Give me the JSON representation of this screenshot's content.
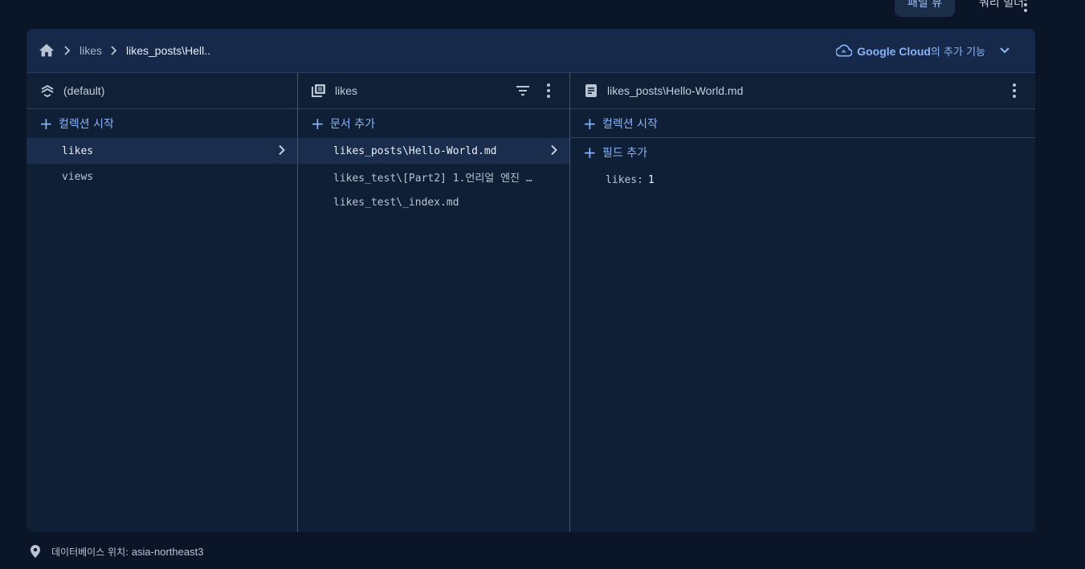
{
  "top_bar": {
    "tabs": [
      {
        "label": "패널 뷰",
        "active": true
      },
      {
        "label": "쿼리 빌더",
        "active": false
      }
    ]
  },
  "breadcrumb": {
    "items": [
      "likes",
      "likes_posts\\Hell.."
    ]
  },
  "google_cloud": {
    "brand": "Google Cloud",
    "suffix": "의 추가 기능"
  },
  "columns": {
    "database": {
      "title": "(default)",
      "add_label": "컬렉션 시작",
      "items": [
        {
          "label": "likes",
          "selected": true
        },
        {
          "label": "views",
          "selected": false
        }
      ]
    },
    "collection": {
      "title": "likes",
      "add_label": "문서 추가",
      "items": [
        {
          "label": "likes_posts\\Hello-World.md",
          "selected": true
        },
        {
          "label": "likes_test\\[Part2] 1.언리얼 엔진 …",
          "selected": false
        },
        {
          "label": "likes_test\\_index.md",
          "selected": false
        }
      ]
    },
    "document": {
      "title": "likes_posts\\Hello-World.md",
      "add_collection_label": "컬렉션 시작",
      "add_field_label": "필드 추가",
      "fields": [
        {
          "key": "likes:",
          "value": "1"
        }
      ]
    }
  },
  "footer": {
    "label": "데이터베이스 위치:",
    "value": "asia-northeast3"
  },
  "colors": {
    "background": "#0a1628",
    "panel": "#0f1f35",
    "accent": "#8ab4f8",
    "selected_row": "#1a2d4d"
  }
}
